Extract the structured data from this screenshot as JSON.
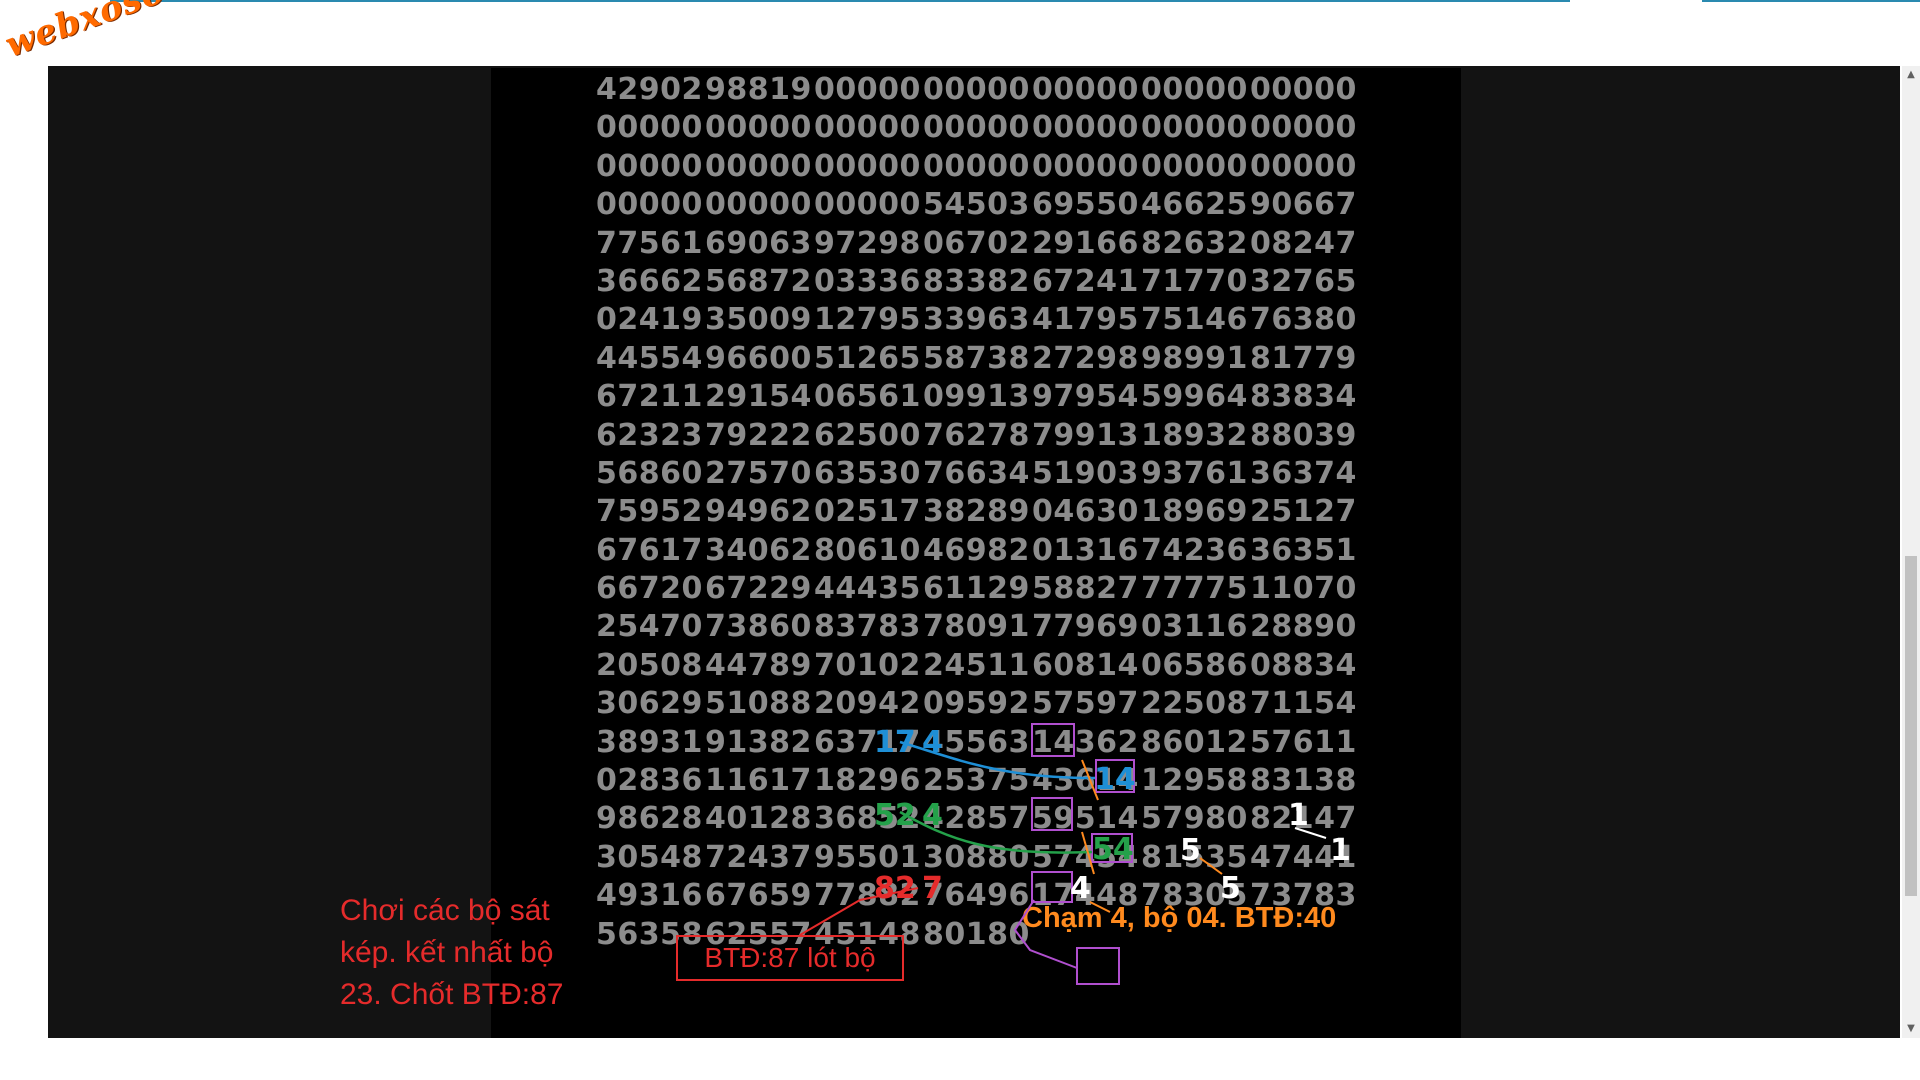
{
  "logo": "webxoso.net",
  "rows": [
    [
      "42902",
      "98819",
      "00000",
      "00000",
      "00000",
      "00000",
      "00000"
    ],
    [
      "00000",
      "00000",
      "00000",
      "00000",
      "00000",
      "00000",
      "00000"
    ],
    [
      "00000",
      "00000",
      "00000",
      "00000",
      "00000",
      "00000",
      "00000"
    ],
    [
      "00000",
      "00000",
      "00000",
      "54503",
      "69550",
      "46625",
      "90667"
    ],
    [
      "77561",
      "69063",
      "97298",
      "06702",
      "29166",
      "82632",
      "08247"
    ],
    [
      "36662",
      "56872",
      "03336",
      "83382",
      "67241",
      "71770",
      "32765"
    ],
    [
      "02419",
      "35009",
      "12795",
      "33963",
      "41795",
      "75146",
      "76380"
    ],
    [
      "44554",
      "96600",
      "51265",
      "58738",
      "27298",
      "98991",
      "81779"
    ],
    [
      "67211",
      "29154",
      "06561",
      "09913",
      "97954",
      "59964",
      "83834"
    ],
    [
      "62323",
      "79222",
      "62500",
      "76278",
      "79913",
      "18932",
      "88039"
    ],
    [
      "56860",
      "27570",
      "63530",
      "76634",
      "51903",
      "93761",
      "36374"
    ],
    [
      "75952",
      "94962",
      "02517",
      "38289",
      "04630",
      "18969",
      "25127"
    ],
    [
      "67617",
      "34062",
      "80610",
      "46982",
      "01316",
      "74236",
      "36351"
    ],
    [
      "66720",
      "67229",
      "44435",
      "61129",
      "58827",
      "77775",
      "11070"
    ],
    [
      "25470",
      "73860",
      "83783",
      "78091",
      "77969",
      "03116",
      "28890"
    ],
    [
      "20508",
      "44789",
      "70102",
      "24511",
      "60814",
      "06586",
      "08834"
    ],
    [
      "30629",
      "51088",
      "20942",
      "09592",
      "57597",
      "22508",
      "71154"
    ],
    [
      "38931",
      "91382",
      "63717",
      "45563",
      "14362",
      "86012",
      "57611"
    ],
    [
      "02836",
      "11617",
      "18296",
      "25375",
      "43614",
      "12958",
      "83138"
    ],
    [
      "98628",
      "40128",
      "36852",
      "42857",
      "59514",
      "57980",
      "82147"
    ],
    [
      "30548",
      "72437",
      "95501",
      "30880",
      "57454",
      "81535",
      "47441"
    ],
    [
      "49316",
      "67659",
      "77882",
      "76496",
      "17448",
      "78305",
      "73783"
    ],
    [
      "56358",
      "62557",
      "45148",
      "80180",
      "",
      "",
      ""
    ]
  ],
  "annotations": {
    "red_note": "Chơi các bộ sát kép. kết nhất bộ 23. Chốt BTĐ:87",
    "red_box": "BTĐ:87 lót bộ",
    "orange_note": "Chạm 4, bộ 04. BTĐ:40",
    "blue_digits": [
      "17",
      "4",
      "14"
    ],
    "green_digits": [
      "52",
      "4",
      "54"
    ],
    "red_digits": [
      "82",
      "7"
    ],
    "white_digits": [
      "1",
      "5",
      "1",
      "5",
      "4"
    ]
  },
  "colors": {
    "frame_bg": "#131313",
    "panel_bg": "#000000",
    "digits": "#8c8c8c",
    "red": "#e52b2b",
    "orange": "#ff8a1e",
    "blue": "#1e8fd6",
    "green": "#24a14a",
    "purple": "#b04fcf",
    "logo": "#ff6a00"
  }
}
